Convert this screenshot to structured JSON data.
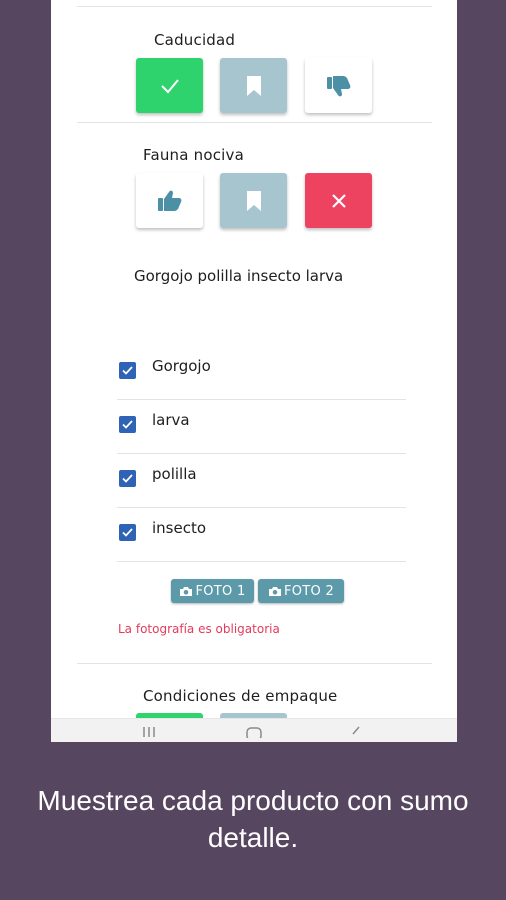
{
  "sections": {
    "expiry": {
      "title": "Caducidad",
      "buttons": [
        "check-icon",
        "bookmark-icon",
        "thumbs-down-icon"
      ]
    },
    "pests": {
      "title": "Fauna nociva",
      "buttons": [
        "thumbs-up-icon",
        "bookmark-icon",
        "close-icon"
      ],
      "description": "Gorgojo polilla insecto larva",
      "checklist": [
        {
          "label": "Gorgojo",
          "checked": true
        },
        {
          "label": "larva",
          "checked": true
        },
        {
          "label": "polilla",
          "checked": true
        },
        {
          "label": "insecto",
          "checked": true
        }
      ],
      "photo_buttons": [
        "FOTO 1",
        "FOTO 2"
      ],
      "error": "La fotografía es obligatoria"
    },
    "packaging": {
      "title": "Condiciones de empaque"
    }
  },
  "colors": {
    "background": "#574660",
    "approve": "#2ed36e",
    "neutral": "#a7c5cf",
    "reject": "#ee4261",
    "photo": "#5d9aa9",
    "error": "#e23b5a",
    "checkbox": "#2f63b6"
  },
  "caption": "Muestrea cada producto con sumo detalle."
}
